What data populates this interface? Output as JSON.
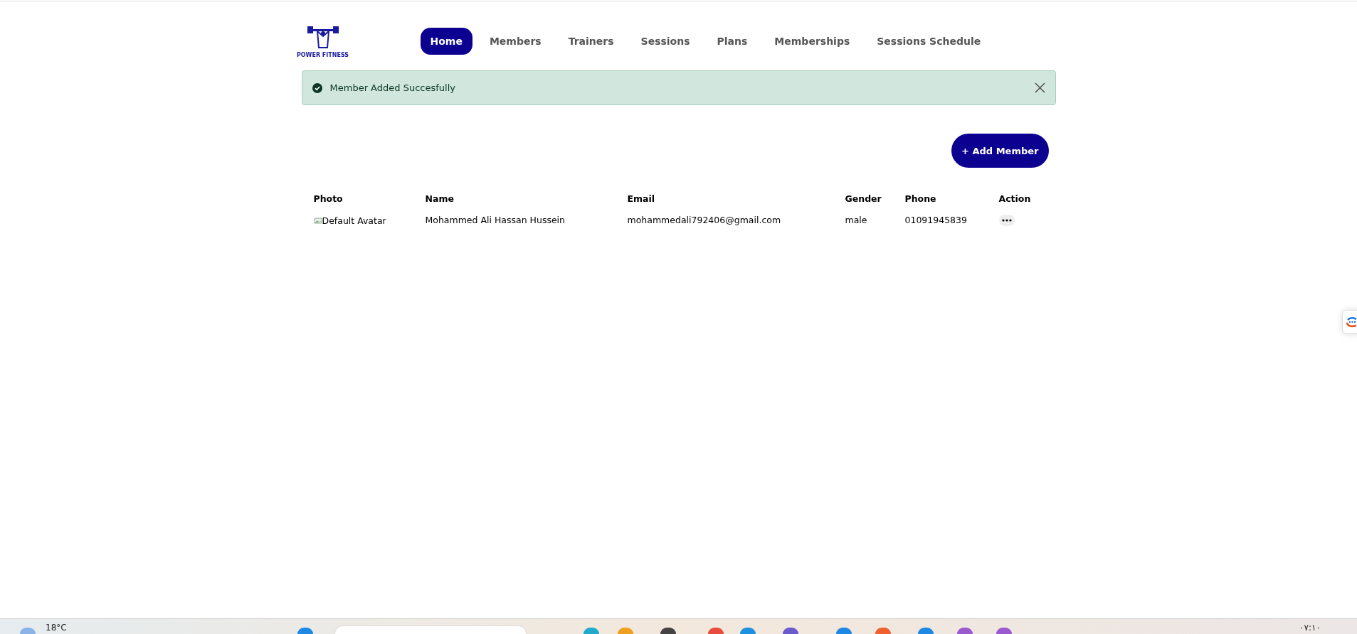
{
  "logo": {
    "caption": "POWER FITNESS"
  },
  "nav": [
    {
      "label": "Home",
      "selected": true
    },
    {
      "label": "Members",
      "selected": false
    },
    {
      "label": "Trainers",
      "selected": false
    },
    {
      "label": "Sessions",
      "selected": false
    },
    {
      "label": "Plans",
      "selected": false
    },
    {
      "label": "Memberships",
      "selected": false
    },
    {
      "label": "Sessions Schedule",
      "selected": false
    }
  ],
  "alert": {
    "message": "Member Added Succesfully"
  },
  "add_button": "+ Add Member",
  "table": {
    "columns": [
      "Photo",
      "Name",
      "Email",
      "Gender",
      "Phone",
      "Action"
    ],
    "rows": [
      {
        "photo": "Default Avatar",
        "name": "Mohammed Ali Hassan Hussein",
        "email": "mohammedali792406@gmail.com",
        "gender": "male",
        "phone": "01091945839"
      }
    ]
  },
  "taskbar": {
    "weather": "18°C",
    "clock": "٠٧:١٠"
  }
}
